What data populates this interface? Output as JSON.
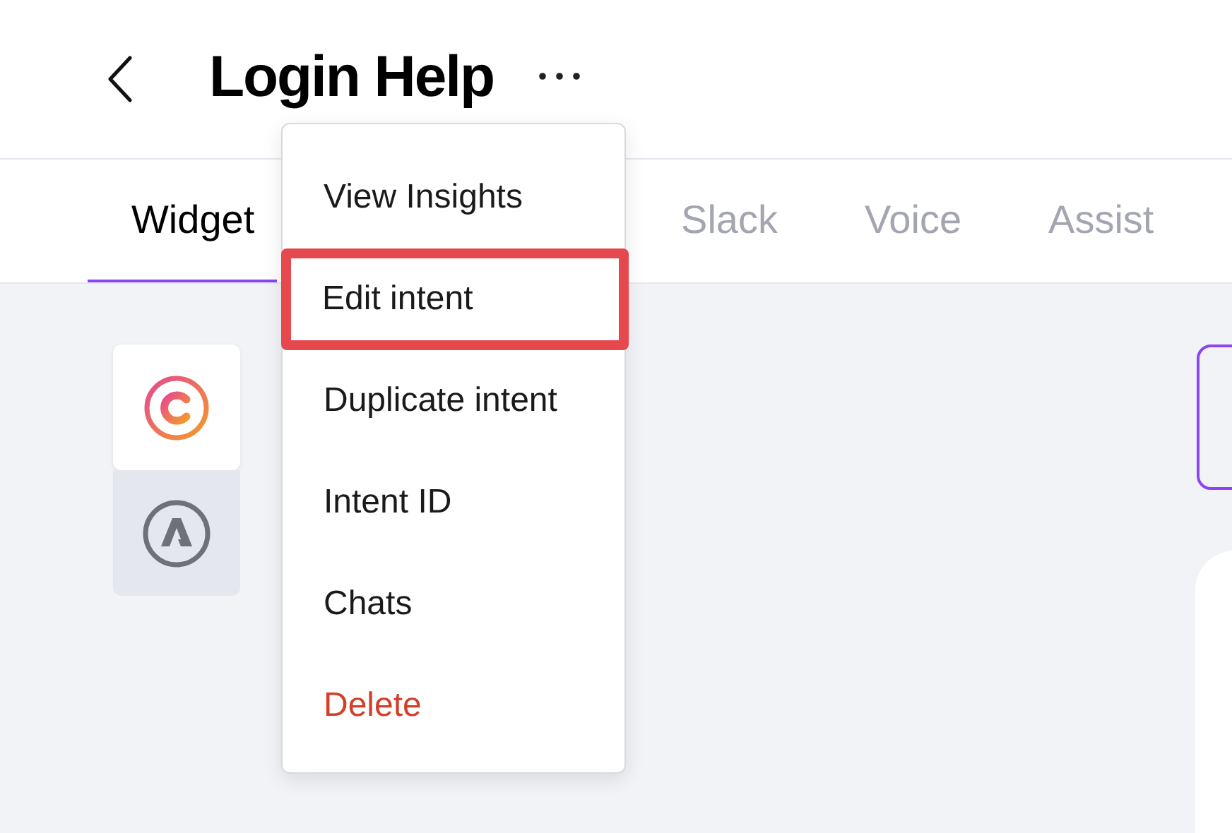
{
  "header": {
    "title": "Login Help"
  },
  "tabs": [
    {
      "label": "Widget",
      "selected": true
    },
    {
      "label": "Slack",
      "selected": false
    },
    {
      "label": "Voice",
      "selected": false
    },
    {
      "label": "Assist",
      "selected": false
    }
  ],
  "channels": [
    {
      "selected": true
    },
    {
      "selected": false
    }
  ],
  "menu": {
    "items": [
      {
        "label": "View Insights",
        "kind": "normal",
        "highlighted": false
      },
      {
        "label": "Edit intent",
        "kind": "normal",
        "highlighted": true
      },
      {
        "label": "Duplicate intent",
        "kind": "normal",
        "highlighted": false
      },
      {
        "label": "Intent ID",
        "kind": "normal",
        "highlighted": false
      },
      {
        "label": "Chats",
        "kind": "normal",
        "highlighted": false
      },
      {
        "label": "Delete",
        "kind": "danger",
        "highlighted": false
      }
    ]
  }
}
